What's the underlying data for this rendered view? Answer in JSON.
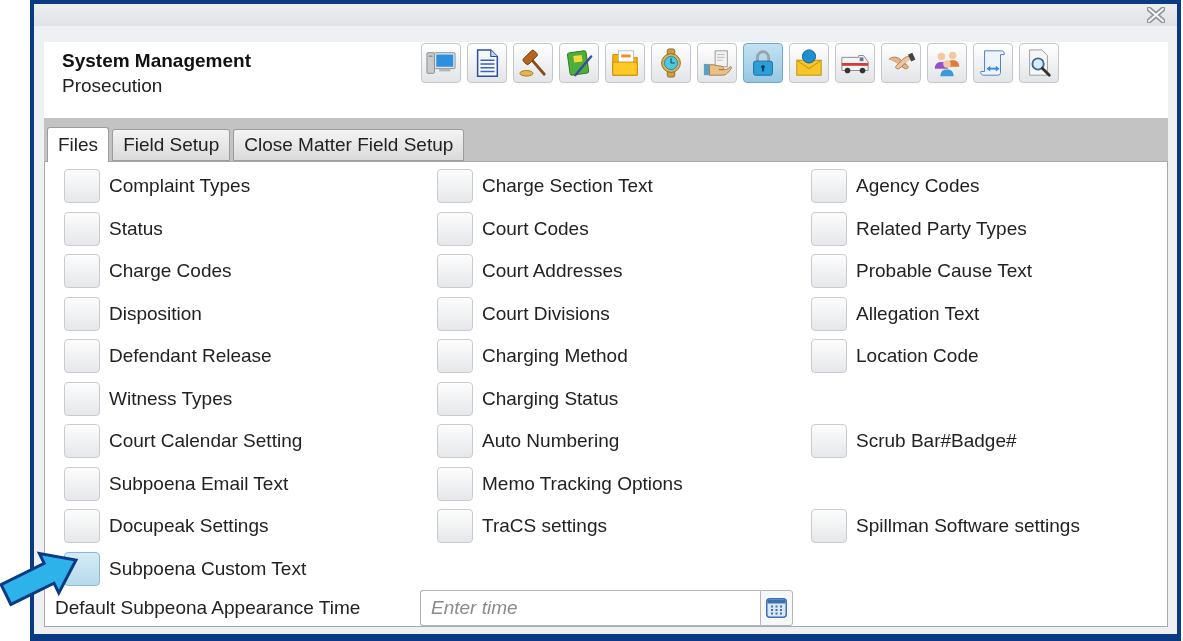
{
  "header": {
    "title": "System Management",
    "subtitle": "Prosecution"
  },
  "toolbar": [
    {
      "selected": false
    },
    {
      "selected": false
    },
    {
      "selected": false
    },
    {
      "selected": false
    },
    {
      "selected": false
    },
    {
      "selected": false
    },
    {
      "selected": false
    },
    {
      "selected": true
    },
    {
      "selected": false
    },
    {
      "selected": false
    },
    {
      "selected": false
    },
    {
      "selected": false
    },
    {
      "selected": false
    },
    {
      "selected": false
    }
  ],
  "tabs": [
    {
      "label": "Files",
      "selected": true
    },
    {
      "label": "Field Setup",
      "selected": false
    },
    {
      "label": "Close Matter Field Setup",
      "selected": false
    }
  ],
  "files": {
    "rows": [
      {
        "column_1": {
          "label": "Complaint Types",
          "highlighted": false
        },
        "column_2": {
          "label": "Charge Section Text",
          "highlighted": false
        },
        "column_3": {
          "label": "Agency Codes",
          "highlighted": false
        }
      },
      {
        "column_1": {
          "label": "Status",
          "highlighted": false
        },
        "column_2": {
          "label": "Court Codes",
          "highlighted": false
        },
        "column_3": {
          "label": "Related Party Types",
          "highlighted": false
        }
      },
      {
        "column_1": {
          "label": "Charge Codes",
          "highlighted": false
        },
        "column_2": {
          "label": "Court Addresses",
          "highlighted": false
        },
        "column_3": {
          "label": "Probable Cause Text",
          "highlighted": false
        }
      },
      {
        "column_1": {
          "label": "Disposition",
          "highlighted": false
        },
        "column_2": {
          "label": "Court Divisions",
          "highlighted": false
        },
        "column_3": {
          "label": "Allegation Text",
          "highlighted": false
        }
      },
      {
        "column_1": {
          "label": "Defendant Release",
          "highlighted": false
        },
        "column_2": {
          "label": "Charging Method",
          "highlighted": false
        },
        "column_3": {
          "label": "Location Code",
          "highlighted": false
        }
      },
      {
        "column_1": {
          "label": "Witness Types",
          "highlighted": false
        },
        "column_2": {
          "label": "Charging Status",
          "highlighted": false
        }
      },
      {
        "column_1": {
          "label": "Court Calendar Setting",
          "highlighted": false
        },
        "column_2": {
          "label": "Auto Numbering",
          "highlighted": false
        },
        "column_3": {
          "label": "Scrub Bar#Badge#",
          "highlighted": false
        }
      },
      {
        "column_1": {
          "label": "Subpoena Email Text",
          "highlighted": false
        },
        "column_2": {
          "label": "Memo Tracking Options",
          "highlighted": false
        }
      },
      {
        "column_1": {
          "label": "Docupeak Settings",
          "highlighted": false
        },
        "column_2": {
          "label": "TraCS settings",
          "highlighted": false
        },
        "column_3": {
          "label": "Spillman Software settings",
          "highlighted": false
        }
      },
      {
        "column_1": {
          "label": "Subpoena Custom Text",
          "highlighted": true
        }
      }
    ]
  },
  "appearance_time": {
    "label": "Default Subpeona Appearance Time",
    "placeholder": "Enter time"
  }
}
